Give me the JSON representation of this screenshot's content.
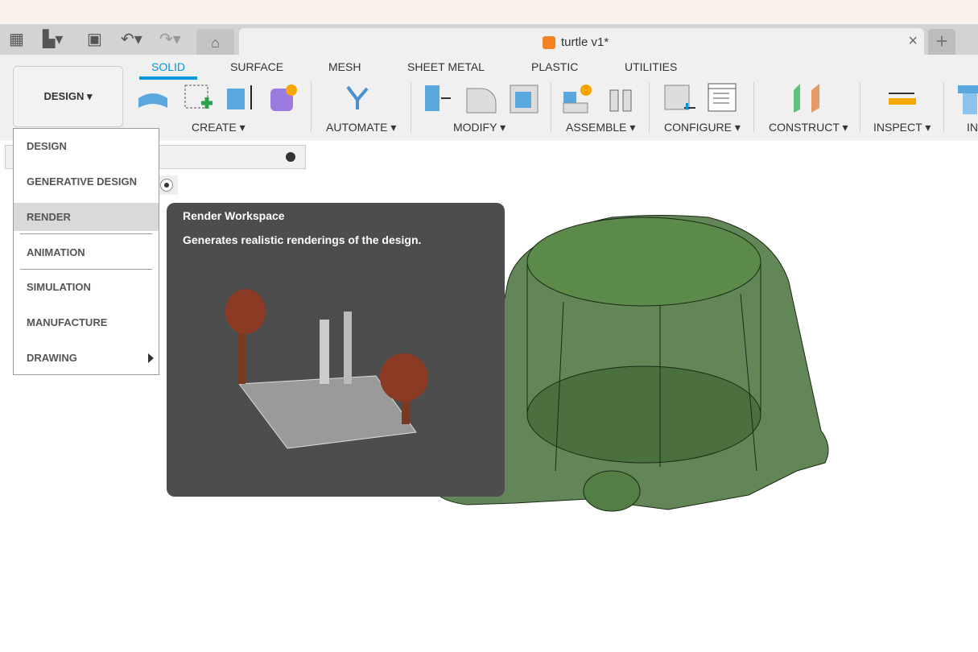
{
  "document": {
    "title": "turtle v1*",
    "icon": "orange-cube-icon"
  },
  "quick_access": {
    "icons": [
      "app-grid-icon",
      "file-icon",
      "save-icon",
      "undo-icon",
      "redo-icon",
      "home-icon"
    ]
  },
  "workspace_button": {
    "label": "DESIGN"
  },
  "ribbon_tabs": [
    {
      "label": "SOLID",
      "active": true
    },
    {
      "label": "SURFACE"
    },
    {
      "label": "MESH"
    },
    {
      "label": "SHEET METAL"
    },
    {
      "label": "PLASTIC"
    },
    {
      "label": "UTILITIES"
    }
  ],
  "groups": [
    {
      "label": "CREATE"
    },
    {
      "label": "AUTOMATE"
    },
    {
      "label": "MODIFY"
    },
    {
      "label": "ASSEMBLE"
    },
    {
      "label": "CONFIGURE"
    },
    {
      "label": "CONSTRUCT"
    },
    {
      "label": "INSPECT"
    },
    {
      "label": "IN"
    }
  ],
  "workspace_menu": {
    "items": [
      {
        "label": "DESIGN"
      },
      {
        "label": "GENERATIVE DESIGN"
      },
      {
        "label": "RENDER",
        "highlighted": true
      },
      {
        "label": "ANIMATION"
      },
      {
        "label": "SIMULATION"
      },
      {
        "label": "MANUFACTURE"
      },
      {
        "label": "DRAWING",
        "submenu": true
      }
    ]
  },
  "tooltip": {
    "title": "Render Workspace",
    "description": "Generates realistic renderings of the design."
  },
  "colors": {
    "accent": "#0696d7",
    "tooltip_bg": "#4d4d4d",
    "model": "#3f6b2f"
  }
}
